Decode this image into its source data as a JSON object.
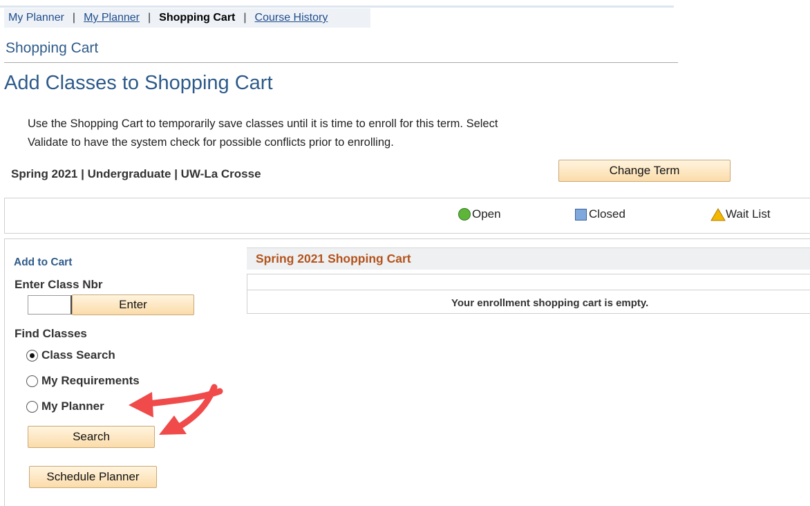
{
  "topnav": {
    "items": [
      {
        "label": "My Planner",
        "style": "link"
      },
      {
        "label": "My Planner",
        "style": "link-underline"
      },
      {
        "label": "Shopping Cart",
        "style": "current"
      },
      {
        "label": "Course History",
        "style": "link-underline"
      }
    ],
    "separator": "|"
  },
  "section_title": "Shopping Cart",
  "page_title": "Add Classes to Shopping Cart",
  "intro": {
    "line1": "Use the Shopping Cart to temporarily save classes until it is time to enroll for this term.  Select",
    "line2": "Validate to have the system check for possible conflicts prior to enrolling."
  },
  "term_label": "Spring 2021 | Undergraduate | UW-La Crosse",
  "change_term_label": "Change Term",
  "legend": {
    "open": "Open",
    "closed": "Closed",
    "wait_list": "Wait List",
    "open_color": "#5fb53a",
    "closed_color": "#7fa8dd",
    "wait_list_color": "#f5b800"
  },
  "add_to_cart": {
    "heading": "Add to Cart",
    "enter_class_label": "Enter Class Nbr",
    "class_nbr_value": "",
    "enter_button": "Enter",
    "find_label": "Find Classes",
    "options": [
      {
        "label": "Class Search",
        "selected": true
      },
      {
        "label": "My Requirements",
        "selected": false
      },
      {
        "label": "My Planner",
        "selected": false
      }
    ],
    "search_button": "Search",
    "schedule_planner_button": "Schedule Planner"
  },
  "cart": {
    "title": "Spring 2021 Shopping Cart",
    "empty_message": "Your enrollment shopping cart is empty."
  },
  "annotation_color": "#f04a4a"
}
